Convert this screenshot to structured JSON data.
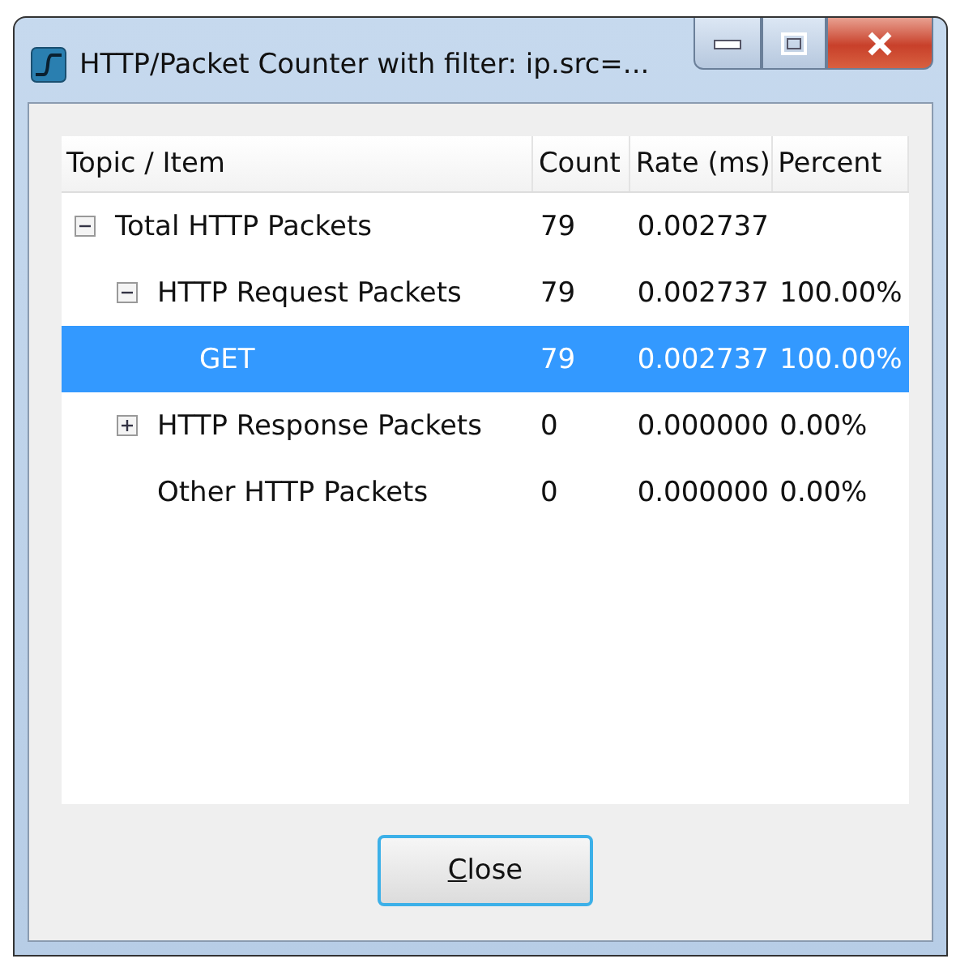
{
  "window": {
    "title": "HTTP/Packet Counter with filter: ip.src=..."
  },
  "table": {
    "columns": [
      "Topic / Item",
      "Count",
      "Rate (ms)",
      "Percent"
    ],
    "rows": [
      {
        "topic": "Total HTTP Packets",
        "count": "79",
        "rate": "0.002737",
        "expanded": true,
        "selected": false,
        "children": [
          {
            "topic": "HTTP Request Packets",
            "count": "79",
            "rate": "0.002737",
            "percent": "100.00%",
            "expanded": true,
            "selected": false,
            "children": [
              {
                "topic": "GET",
                "count": "79",
                "rate": "0.002737",
                "percent": "100.00%",
                "selected": true
              }
            ]
          },
          {
            "topic": "HTTP Response Packets",
            "count": "0",
            "rate": "0.000000",
            "percent": "0.00%",
            "expanded": false,
            "selected": false
          },
          {
            "topic": "Other HTTP Packets",
            "count": "0",
            "rate": "0.000000",
            "percent": "0.00%",
            "selected": false
          }
        ]
      }
    ]
  },
  "buttons": [
    "Close"
  ]
}
